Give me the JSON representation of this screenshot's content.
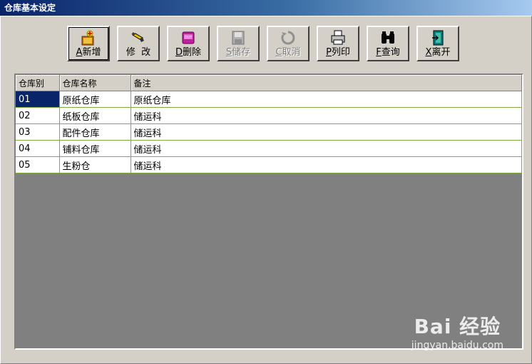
{
  "window": {
    "title": "仓库基本设定"
  },
  "toolbar": {
    "buttons": [
      {
        "hotkey": "A",
        "label": "新增",
        "icon": "add-box-icon",
        "enabled": true
      },
      {
        "hotkey": "",
        "label": "修  改",
        "icon": "edit-pencil-icon",
        "enabled": true
      },
      {
        "hotkey": "D",
        "label": "删除",
        "icon": "delete-out-icon",
        "enabled": true
      },
      {
        "hotkey": "S",
        "label": "储存",
        "icon": "save-disk-icon",
        "enabled": false
      },
      {
        "hotkey": "C",
        "label": "取消",
        "icon": "cancel-recycle-icon",
        "enabled": false
      },
      {
        "hotkey": "P",
        "label": "列印",
        "icon": "printer-icon",
        "enabled": true
      },
      {
        "hotkey": "F",
        "label": "查询",
        "icon": "binoculars-icon",
        "enabled": true
      },
      {
        "hotkey": "X",
        "label": "离开",
        "icon": "exit-door-icon",
        "enabled": true
      }
    ]
  },
  "grid": {
    "columns": [
      "仓库别",
      "仓库名称",
      "备注"
    ],
    "rows": [
      [
        "01",
        "原纸仓库",
        "原纸仓库"
      ],
      [
        "02",
        "纸板仓库",
        "储运科"
      ],
      [
        "03",
        "配件仓库",
        "储运科"
      ],
      [
        "04",
        "铺料仓库",
        "储运科"
      ],
      [
        "05",
        "生粉仓",
        "储运科"
      ]
    ]
  },
  "watermark": {
    "main": "Bai 经验",
    "sub": "jingyan.baidu.com"
  },
  "colors": {
    "title_bar": "#0a246a",
    "selection": "#0a246a",
    "grid_empty": "#808080",
    "grid_lines": "#7fae3f"
  }
}
